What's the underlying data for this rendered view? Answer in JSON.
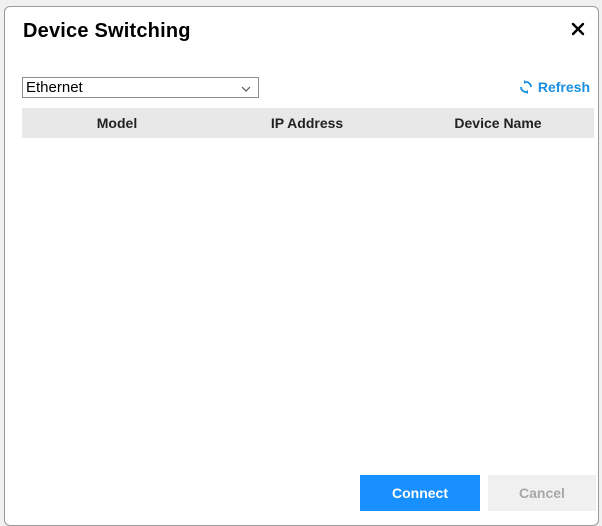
{
  "dialog": {
    "title": "Device Switching",
    "close_icon": "close-icon"
  },
  "connection": {
    "selected": "Ethernet"
  },
  "refresh": {
    "label": "Refresh",
    "icon": "refresh-icon",
    "color": "#1a8fe0"
  },
  "table": {
    "columns": [
      "Model",
      "IP Address",
      "Device Name"
    ],
    "rows": []
  },
  "buttons": {
    "connect_label": "Connect",
    "cancel_label": "Cancel",
    "connect_color": "#1890ff",
    "cancel_disabled": true
  }
}
